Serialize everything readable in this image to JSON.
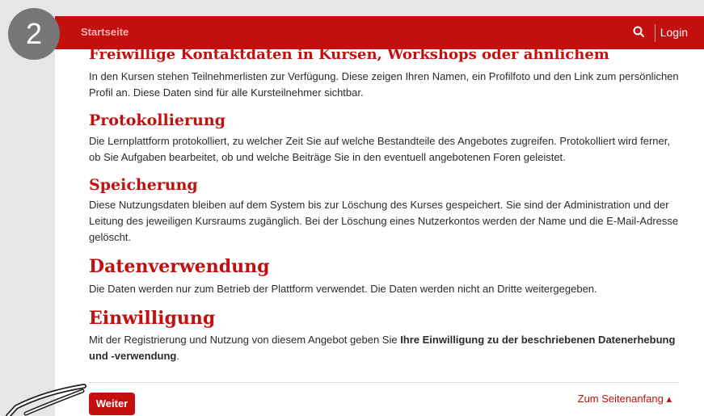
{
  "step_number": "2",
  "nav": {
    "home_label": "Startseite",
    "login_label": "Login",
    "search_icon": "search-icon"
  },
  "sections": [
    {
      "heading": "Freiwillige Kontaktdaten in Kursen, Workshops oder ähnlichem",
      "text": "In den Kursen stehen Teilnehmerlisten zur Verfügung. Diese zeigen Ihren Namen, ein Profilfoto und den Link zum persönlichen Profil an. Diese Daten sind für alle Kursteilnehmer sichtbar."
    },
    {
      "heading": "Protokollierung",
      "text": "Die Lernplattform protokolliert, zu welcher Zeit Sie auf welche Bestandteile des Angebotes zugreifen. Protokolliert wird ferner, ob Sie Aufgaben bearbeitet, ob und welche Beiträge Sie in den eventuell angebotenen Foren geleistet."
    },
    {
      "heading": "Speicherung",
      "text": "Diese Nutzungsdaten bleiben auf dem System bis zur Löschung des Kurses gespeichert. Sie sind der Administration und der Leitung des jeweiligen Kursraums zugänglich. Bei der Löschung eines Nutzerkontos werden der Name und die E-Mail-Adresse gelöscht."
    },
    {
      "heading": "Datenverwendung",
      "text": "Die Daten werden nur zum Betrieb der Plattform verwendet. Die Daten werden nicht an Dritte weitergegeben."
    },
    {
      "heading": "Einwilligung",
      "text_before": "Mit der Registrierung und Nutzung von diesem Angebot geben Sie ",
      "text_bold": "Ihre Einwilligung zu der beschriebenen Datenerhebung und -verwendung",
      "text_after": "."
    }
  ],
  "footer": {
    "button_label": "Weiter",
    "top_link_label": "Zum Seitenanfang ▴"
  },
  "colors": {
    "brand_red": "#c40f0f",
    "badge_gray": "#777777"
  }
}
